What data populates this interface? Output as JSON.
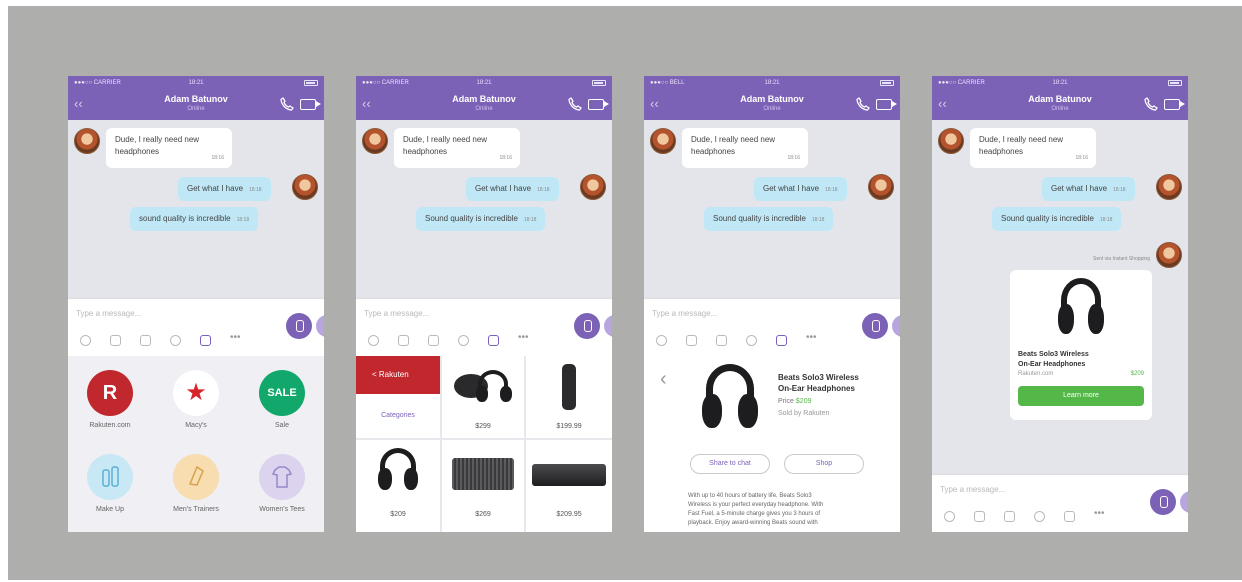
{
  "status": {
    "carrier_a": "●●●○○ CARRIER",
    "carrier_b": "●●●○○ BELL",
    "time": "18:21"
  },
  "contact": {
    "name": "Adam Batunov",
    "status": "Online"
  },
  "messages": [
    {
      "text_1": "Dude, I really need new",
      "text_2": "headphones",
      "time": "18:16"
    },
    {
      "text": "Get what I have",
      "time": "18:18"
    },
    {
      "text_lower": "sound quality is incredible",
      "text": "Sound quality is incredible",
      "time": "18:18"
    }
  ],
  "composer": {
    "placeholder": "Type a message..."
  },
  "apps": [
    {
      "label": "Rakuten.com",
      "glyph": "R",
      "color": "#c0282e"
    },
    {
      "label": "Macy's",
      "glyph": "★",
      "color": "#ffffff"
    },
    {
      "label": "Sale",
      "glyph": "SALE",
      "color": "#13a86b"
    },
    {
      "label": "Make Up",
      "glyph": "",
      "color": "#c9e8f5"
    },
    {
      "label": "Men's Trainers",
      "glyph": "",
      "color": "#f7ddb0"
    },
    {
      "label": "Women's Tees",
      "glyph": "",
      "color": "#dcd3ee"
    }
  ],
  "store": {
    "back_label": "< Rakuten",
    "categories": "Categories"
  },
  "products": [
    {
      "price": "$299"
    },
    {
      "price": "$199.99"
    },
    {
      "price": "$209"
    },
    {
      "price": "$269"
    },
    {
      "price": "$209.95"
    }
  ],
  "detail": {
    "title_1": "Beats Solo3 Wireless",
    "title_2": "On-Ear Headphones",
    "price_label": "Price",
    "price": "$209",
    "seller": "Sold by Rakuten",
    "share_button": "Share to chat",
    "shop_button": "Shop",
    "desc_1": "With up to 40 hours of battery life, Beats Solo3",
    "desc_2": "Wireless is your perfect everyday headphone. With",
    "desc_3": "Fast Fuel, a 5-minute charge gives you 3 hours of",
    "desc_4": "playback. Enjoy award-winning Beats sound with"
  },
  "shared": {
    "note": "Sent via Instant Shopping",
    "title_1": "Beats Solo3 Wireless",
    "title_2": "On-Ear Headphones",
    "source": "Rakuten.com",
    "price": "$209",
    "button": "Learn more"
  },
  "colors": {
    "brand": "#7c62b7",
    "bubble_out": "#bfe7f6",
    "green": "#54b848",
    "red": "#c0282e"
  }
}
